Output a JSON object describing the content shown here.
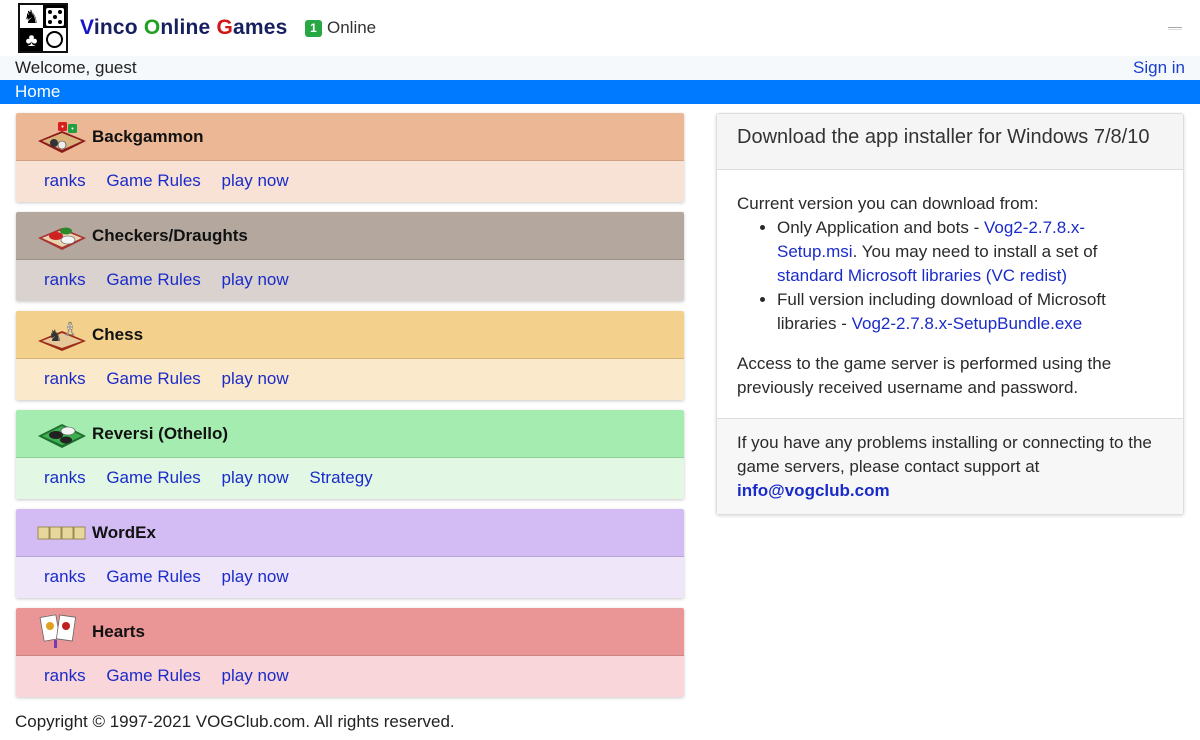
{
  "header": {
    "brand": {
      "v": "V",
      "v_rest": "inco ",
      "o": "O",
      "o_rest": "nline ",
      "g": "G",
      "g_rest": "ames"
    },
    "online_count": "1",
    "online_label": "Online",
    "welcome": "Welcome, guest",
    "sign_in": "Sign in",
    "nav_home": "Home"
  },
  "games": [
    {
      "title": "Backgammon",
      "icon": "backgammon-icon",
      "links": [
        "ranks",
        "Game Rules",
        "play now"
      ]
    },
    {
      "title": "Checkers/Draughts",
      "icon": "checkers-icon",
      "links": [
        "ranks",
        "Game Rules",
        "play now"
      ]
    },
    {
      "title": "Chess",
      "icon": "chess-icon",
      "links": [
        "ranks",
        "Game Rules",
        "play now"
      ]
    },
    {
      "title": "Reversi (Othello)",
      "icon": "reversi-icon",
      "links": [
        "ranks",
        "Game Rules",
        "play now",
        "Strategy"
      ]
    },
    {
      "title": "WordEx",
      "icon": "wordex-icon",
      "links": [
        "ranks",
        "Game Rules",
        "play now"
      ]
    },
    {
      "title": "Hearts",
      "icon": "hearts-cards-icon",
      "links": [
        "ranks",
        "Game Rules",
        "play now"
      ]
    }
  ],
  "download": {
    "title": "Download the app installer for Windows 7/8/10",
    "intro": "Current version you can download from:",
    "item1_text": "Only Application and bots - ",
    "item1_link": "Vog2-2.7.8.x-Setup.msi",
    "item1_text2": ". You may need to install a set of ",
    "item1_link2": "standard Microsoft libraries (VC redist)",
    "item2_text": "Full version including download of Microsoft libraries - ",
    "item2_link": "Vog2-2.7.8.x-SetupBundle.exe",
    "access": "Access to the game server is performed using the previously received username and password.",
    "support_text": "If you have any problems installing or connecting to the game servers, please contact support at ",
    "support_email": "info@vogclub.com"
  },
  "footer": {
    "copyright": "Copyright © 1997-2021 VOGClub.com. All rights reserved."
  },
  "colors": {
    "nav": "#007bff",
    "online_badge": "#28a745",
    "link": "#1a2bc9"
  }
}
